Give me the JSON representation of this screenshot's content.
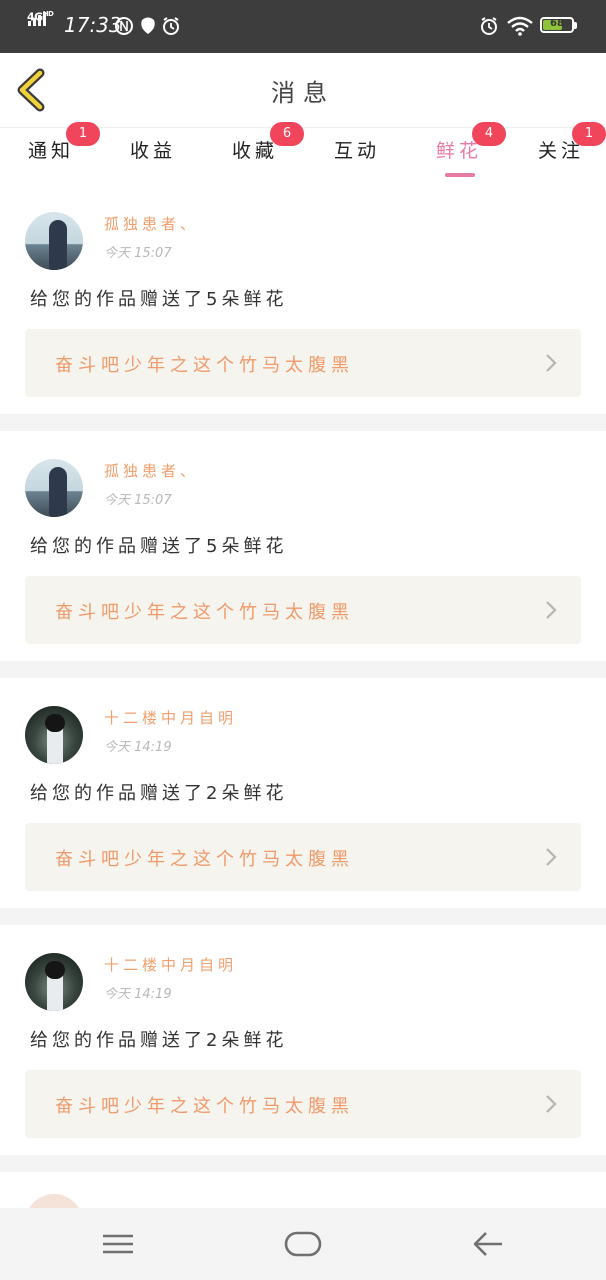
{
  "status_bar": {
    "network": "4G",
    "network_sup": "HD",
    "time": "17:33",
    "battery": "68",
    "battery_level": 0.68,
    "icons": [
      "signal-icon",
      "nfc-icon",
      "shield-icon",
      "alarm-icon",
      "alarm-icon",
      "wifi-icon",
      "battery-icon"
    ]
  },
  "header": {
    "title": "消息",
    "back_icon": "chevron-left-icon"
  },
  "tabs": [
    {
      "label": "通知",
      "badge": "1",
      "active": false
    },
    {
      "label": "收益",
      "badge": "",
      "active": false
    },
    {
      "label": "收藏",
      "badge": "6",
      "active": false
    },
    {
      "label": "互动",
      "badge": "",
      "active": false
    },
    {
      "label": "鲜花",
      "badge": "4",
      "active": true
    },
    {
      "label": "关注",
      "badge": "1",
      "active": false
    }
  ],
  "feed": [
    {
      "username": "孤独患者、",
      "time": "今天 15:07",
      "message": "给您的作品赠送了5朵鲜花",
      "work_title": "奋斗吧少年之这个竹马太腹黑"
    },
    {
      "username": "孤独患者、",
      "time": "今天 15:07",
      "message": "给您的作品赠送了5朵鲜花",
      "work_title": "奋斗吧少年之这个竹马太腹黑"
    },
    {
      "username": "十二楼中月自明",
      "time": "今天 14:19",
      "message": "给您的作品赠送了2朵鲜花",
      "work_title": "奋斗吧少年之这个竹马太腹黑"
    },
    {
      "username": "十二楼中月自明",
      "time": "今天 14:19",
      "message": "给您的作品赠送了2朵鲜花",
      "work_title": "奋斗吧少年之这个竹马太腹黑"
    }
  ],
  "colors": {
    "accent": "#e87aa6",
    "badge": "#f0455a",
    "username": "#f0a06e",
    "work_title": "#ef9a6a",
    "work_bg": "#f5f4ee",
    "status_bar_bg": "#3d3d3d"
  },
  "nav_bar": {
    "icons": [
      "menu-icon",
      "home-icon",
      "back-arrow-icon"
    ]
  }
}
